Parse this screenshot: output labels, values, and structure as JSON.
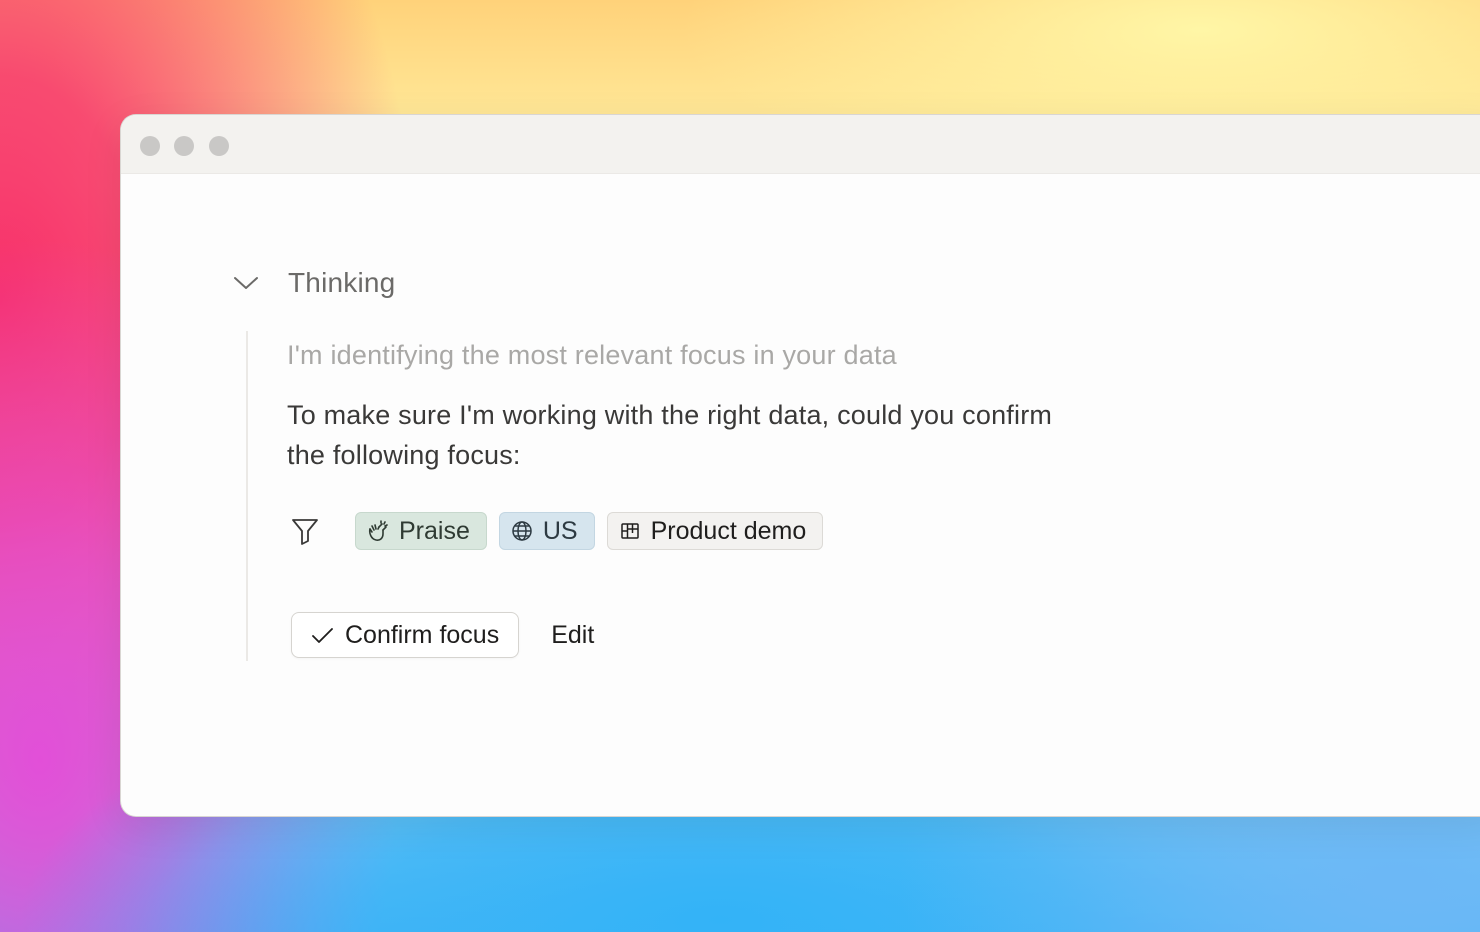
{
  "window": {
    "controls": [
      "close",
      "minimize",
      "zoom"
    ]
  },
  "thinking": {
    "label": "Thinking",
    "icon": "chevron-down-icon",
    "status": "I'm identifying the most relevant focus in your data",
    "question": "To make sure I'm working with the right data, could you confirm the following focus:"
  },
  "focus": {
    "filter_icon": "filter-icon",
    "chips": [
      {
        "label": "Praise",
        "icon": "clapping-hands-icon",
        "color": "#d9e7de"
      },
      {
        "label": "US",
        "icon": "globe-icon",
        "color": "#d6e5ee"
      },
      {
        "label": "Product demo",
        "icon": "board-icon",
        "color": "#f3f2f0"
      }
    ]
  },
  "actions": {
    "confirm_label": "Confirm focus",
    "edit_label": "Edit"
  }
}
